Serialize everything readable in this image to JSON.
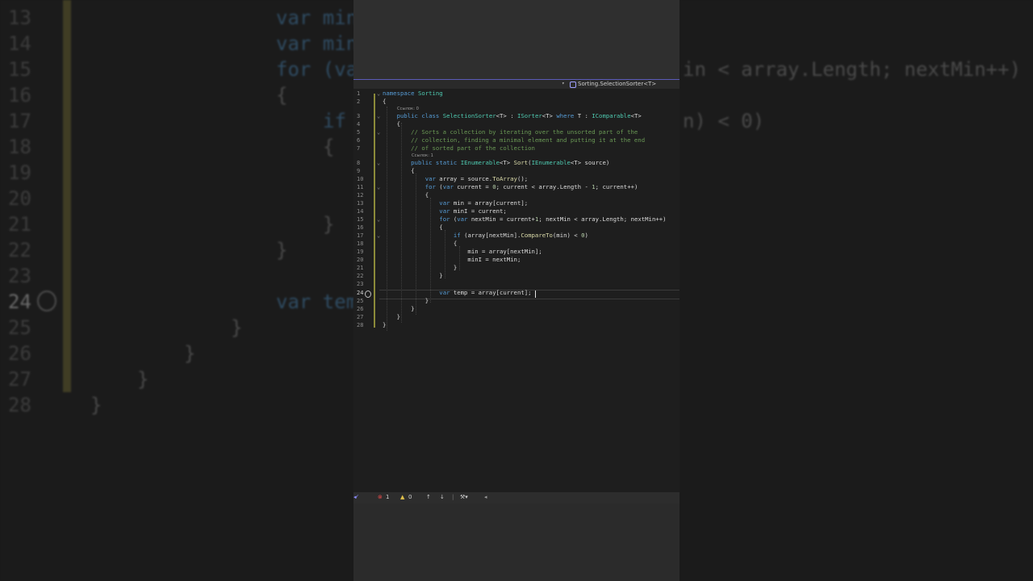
{
  "window": {
    "nav_breadcrumb": "Sorting.SelectionSorter<T>",
    "accent_color": "#5b5bb8"
  },
  "editor": {
    "lines": [
      {
        "num": "1",
        "text": "namespace Sorting"
      },
      {
        "num": "2",
        "text": "{"
      },
      {
        "num": "3",
        "text": "    public class SelectionSorter<T> : ISorter<T> where T : IComparable<T>"
      },
      {
        "num": "4",
        "text": "    {"
      },
      {
        "num": "5",
        "text": "        // Sorts a collection by iterating over the unsorted part of the"
      },
      {
        "num": "6",
        "text": "        // collection, finding a minimal element and putting it at the end"
      },
      {
        "num": "7",
        "text": "        // of sorted part of the collection"
      },
      {
        "num": "8",
        "text": "        public static IEnumerable<T> Sort(IEnumerable<T> source)"
      },
      {
        "num": "9",
        "text": "        {"
      },
      {
        "num": "10",
        "text": "            var array = source.ToArray();"
      },
      {
        "num": "11",
        "text": "            for (var current = 0; current < array.Length - 1; current++)"
      },
      {
        "num": "12",
        "text": "            {"
      },
      {
        "num": "13",
        "text": "                var min = array[current];"
      },
      {
        "num": "14",
        "text": "                var minI = current;"
      },
      {
        "num": "15",
        "text": "                for (var nextMin = current+1; nextMin < array.Length; nextMin++)"
      },
      {
        "num": "16",
        "text": "                {"
      },
      {
        "num": "17",
        "text": "                    if (array[nextMin].CompareTo(min) < 0)"
      },
      {
        "num": "18",
        "text": "                    {"
      },
      {
        "num": "19",
        "text": "                        min = array[nextMin];"
      },
      {
        "num": "20",
        "text": "                        minI = nextMin;"
      },
      {
        "num": "21",
        "text": "                    }"
      },
      {
        "num": "22",
        "text": "                }"
      },
      {
        "num": "23",
        "text": ""
      },
      {
        "num": "24",
        "text": "                var temp = array[current];"
      },
      {
        "num": "25",
        "text": "            }"
      },
      {
        "num": "26",
        "text": "        }"
      },
      {
        "num": "27",
        "text": "    }"
      },
      {
        "num": "28",
        "text": "}"
      }
    ],
    "refs": {
      "class_refs": "Ссылок: 0",
      "method_refs": "Ссылок: 1"
    },
    "current_line": "24"
  },
  "status_bar": {
    "errors": "1",
    "warnings": "0",
    "up_arrow": "↑",
    "down_arrow": "↓"
  },
  "background": {
    "lines": [
      {
        "num": "13",
        "text": "var min"
      },
      {
        "num": "14",
        "text": "var min"
      },
      {
        "num": "15",
        "text": "for (va"
      },
      {
        "num": "16",
        "text": "{"
      },
      {
        "num": "17",
        "text": "if"
      },
      {
        "num": "18",
        "text": "{"
      },
      {
        "num": "19",
        "text": ""
      },
      {
        "num": "20",
        "text": ""
      },
      {
        "num": "21",
        "text": "}"
      },
      {
        "num": "22",
        "text": "}"
      },
      {
        "num": "23",
        "text": ""
      },
      {
        "num": "24",
        "text": "var tem"
      },
      {
        "num": "25",
        "text": "}"
      },
      {
        "num": "26",
        "text": "}"
      },
      {
        "num": "27",
        "text": "}"
      },
      {
        "num": "28",
        "text": "}"
      }
    ],
    "right_line_15": "in < array.Length; nextMin++)",
    "right_line_17": "n) < 0)"
  }
}
